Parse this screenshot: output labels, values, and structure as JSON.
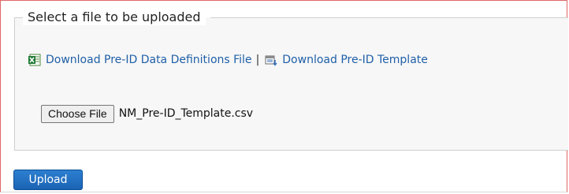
{
  "form": {
    "legend": "Select a file to be uploaded",
    "links": {
      "data_definitions": "Download Pre-ID Data Definitions File",
      "separator": "|",
      "template": "Download Pre-ID Template"
    },
    "file_input": {
      "button_label": "Choose File",
      "selected_file": "NM_Pre-ID_Template.csv"
    },
    "upload_label": "Upload"
  },
  "icons": {
    "data_definitions": "excel-file-icon",
    "template": "csv-download-icon"
  },
  "colors": {
    "link": "#1f5fa8",
    "upload_button": "#1b63b3",
    "panel_border": "#e06666",
    "fieldset_bg": "#f7f7f7"
  }
}
